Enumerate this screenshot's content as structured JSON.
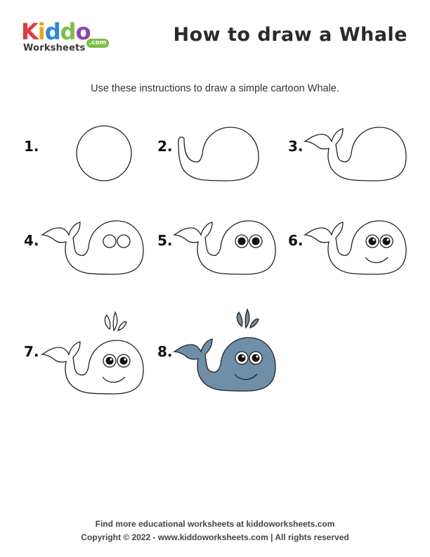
{
  "logo": {
    "letters": [
      "K",
      "i",
      "d",
      "d",
      "o"
    ],
    "letter_colors": [
      "#e63946",
      "#f4a300",
      "#2e86de",
      "#7bc043",
      "#8e44ad"
    ],
    "subtitle": "Worksheets",
    "com": ".com"
  },
  "header": {
    "title": "How to draw a Whale"
  },
  "instructions": "Use these instructions to draw a simple cartoon Whale.",
  "steps": [
    {
      "number": "1."
    },
    {
      "number": "2."
    },
    {
      "number": "3."
    },
    {
      "number": "4."
    },
    {
      "number": "5."
    },
    {
      "number": "6."
    },
    {
      "number": "7."
    },
    {
      "number": "8."
    }
  ],
  "colors": {
    "outline": "#222222",
    "whale_fill": "#6f8fa8"
  },
  "footer": {
    "line1": "Find more educational worksheets at kiddoworksheets.com",
    "line2": "Copyright © 2022 - www.kiddoworksheets.com  |  All rights reserved"
  }
}
